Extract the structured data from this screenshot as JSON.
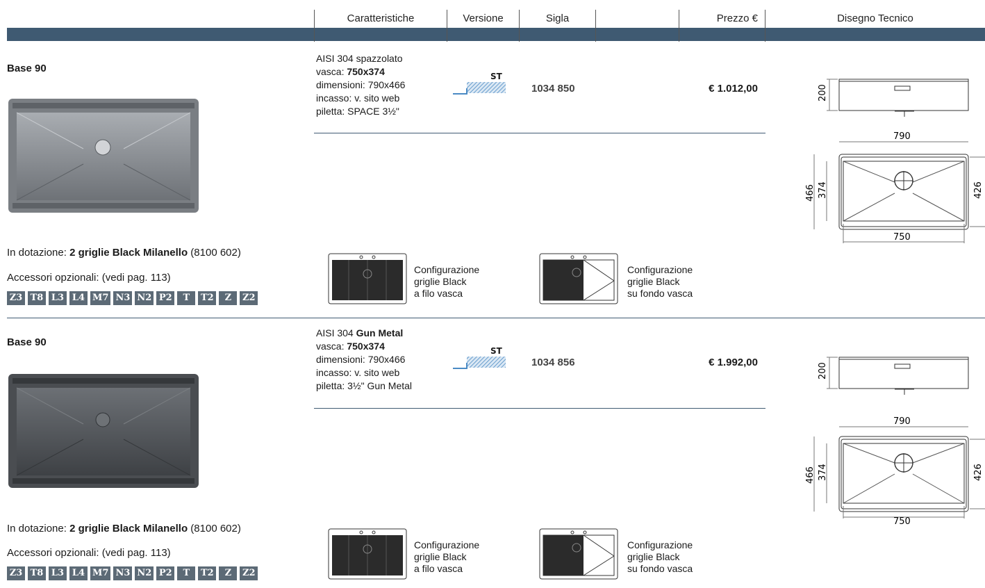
{
  "header": {
    "caratteristiche": "Caratteristiche",
    "versione": "Versione",
    "sigla": "Sigla",
    "prezzo": "Prezzo €",
    "disegno": "Disegno Tecnico"
  },
  "colors": {
    "band": "#3f5a72",
    "badge": "#5c6a76",
    "hatch": "#4a8ac4"
  },
  "products": [
    {
      "title": "Base 90",
      "spec": {
        "l1": "AISI 304 spazzolato",
        "l2_pre": "vasca: ",
        "l2_bold": "750x374",
        "l3": "dimensioni: 790x466",
        "l4": "incasso: v. sito web",
        "l5": "piletta: SPACE 3½\""
      },
      "version": "ST",
      "code": "1034 850",
      "price": "€ 1.012,00",
      "dotazione": {
        "pre": "In dotazione: ",
        "bold": "2 griglie Black Milanello",
        "post": " (8100 602)"
      },
      "accessori": "Accessori opzionali: (vedi pag. 113)",
      "config1": [
        "Configurazione",
        "griglie Black",
        "a filo vasca"
      ],
      "config2": [
        "Configurazione",
        "griglie Black",
        "su fondo vasca"
      ],
      "drawing": {
        "h": "200",
        "w": "790",
        "d": "466",
        "vd": "374",
        "ih": "426",
        "vw": "750"
      },
      "sink_color": "#8a8e94"
    },
    {
      "title": "Base 90",
      "spec": {
        "l1_pre": "AISI 304 ",
        "l1_bold": "Gun Metal",
        "l2_pre": "vasca: ",
        "l2_bold": "750x374",
        "l3": "dimensioni: 790x466",
        "l4": "incasso: v. sito web",
        "l5": "piletta: 3½\" Gun Metal"
      },
      "version": "ST",
      "code": "1034 856",
      "price": "€ 1.992,00",
      "dotazione": {
        "pre": "In dotazione: ",
        "bold": "2 griglie Black Milanello",
        "post": " (8100 602)"
      },
      "accessori": "Accessori opzionali: (vedi pag. 113)",
      "config1": [
        "Configurazione",
        "griglie Black",
        "a filo vasca"
      ],
      "config2": [
        "Configurazione",
        "griglie Black",
        "su fondo vasca"
      ],
      "drawing": {
        "h": "200",
        "w": "790",
        "d": "466",
        "vd": "374",
        "ih": "426",
        "vw": "750"
      },
      "sink_color": "#55595e"
    }
  ],
  "badges": [
    "Z3",
    "T8",
    "L3",
    "L4",
    "M7",
    "N3",
    "N2",
    "P2",
    "T",
    "T2",
    "Z",
    "Z2"
  ]
}
